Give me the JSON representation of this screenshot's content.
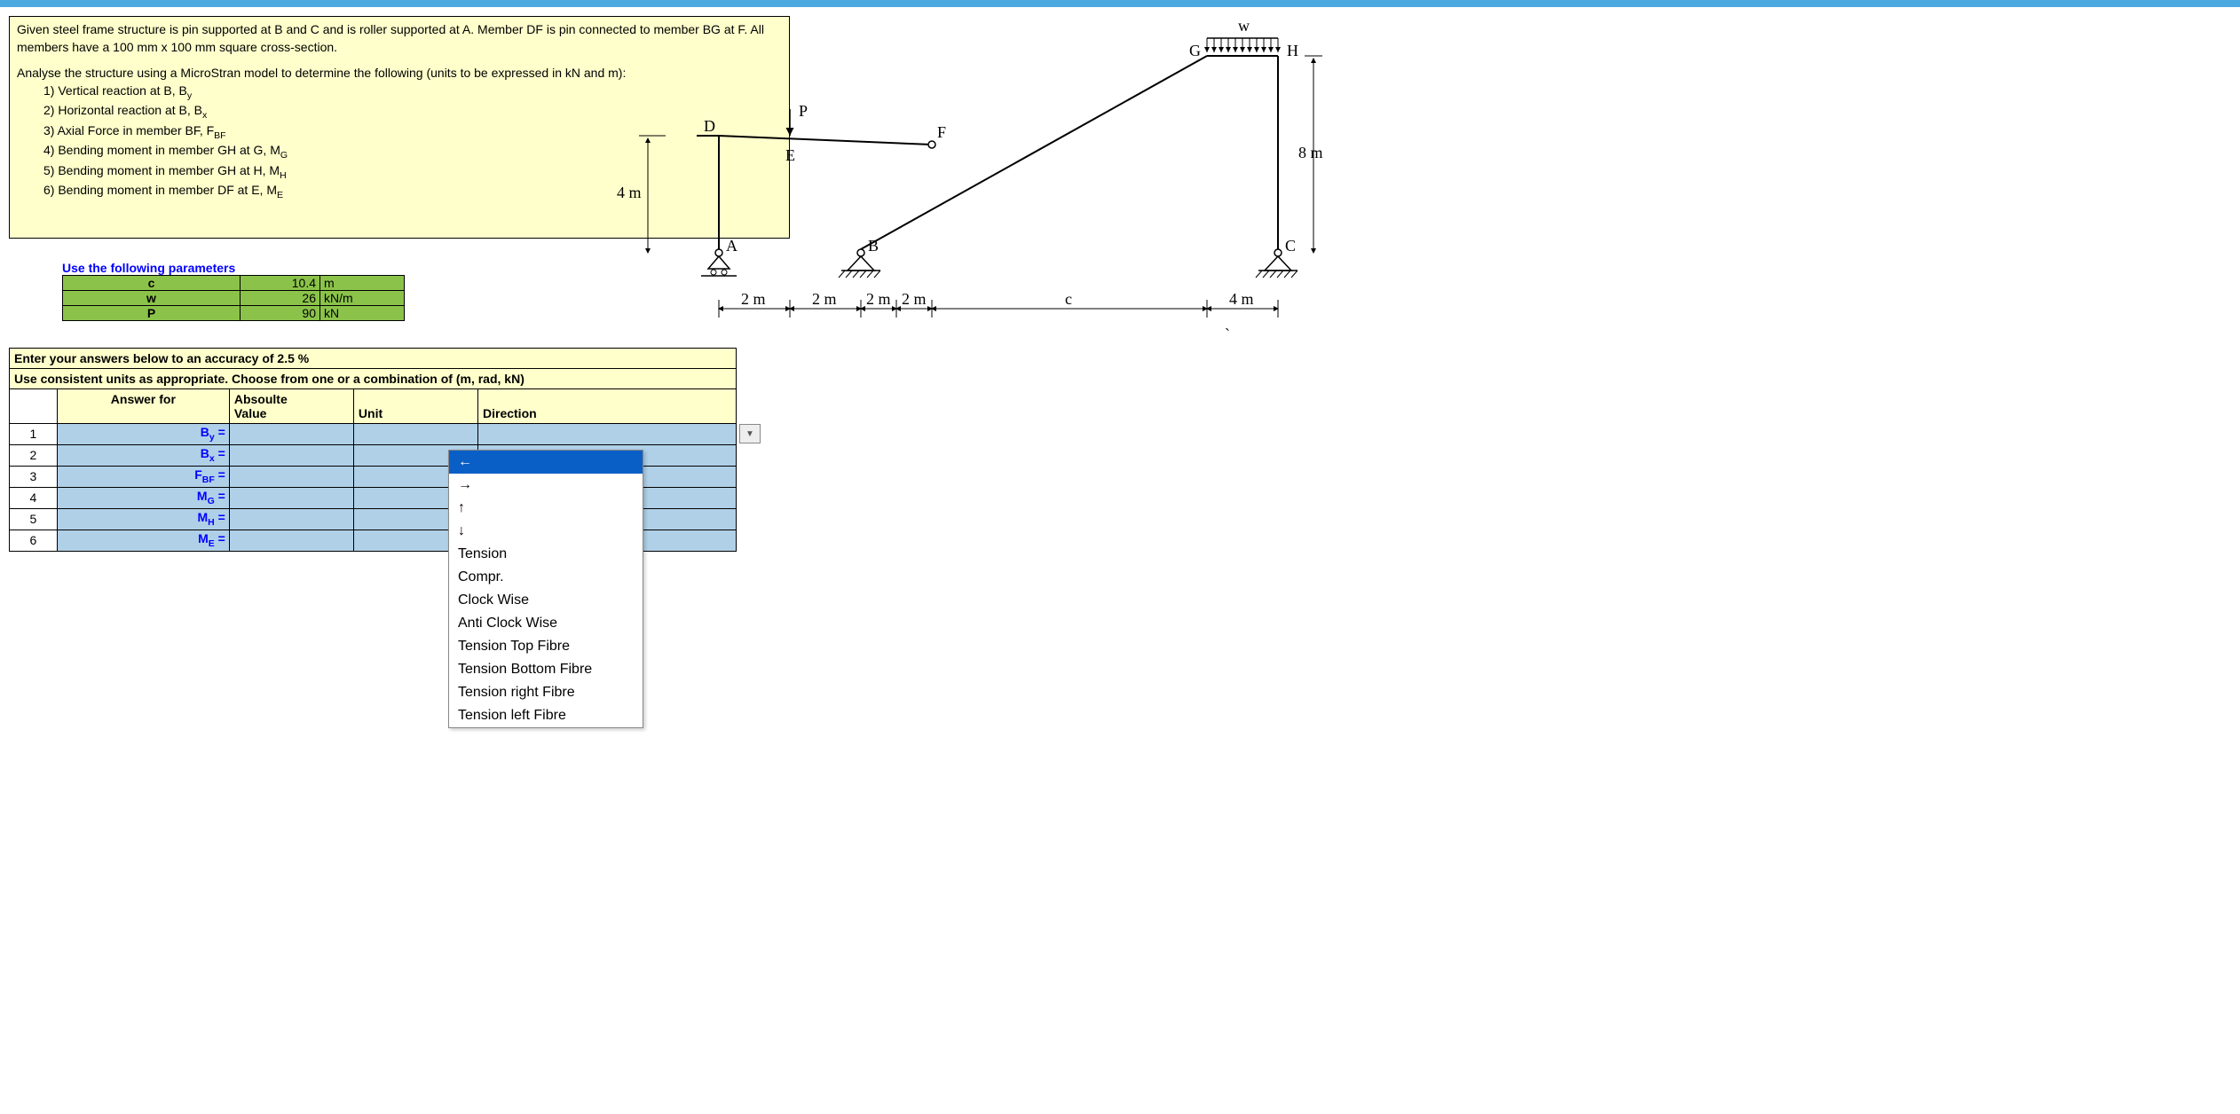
{
  "problem": {
    "intro": "Given steel frame structure is pin supported at B and C and is roller supported at A. Member DF is pin connected to member BG at F. All members have a 100  mm x 100 mm square cross-section.",
    "task": "Analyse the structure using a MicroStran model to determine the following (units to be expressed in kN and m):",
    "items": [
      "1) Vertical reaction at B,  Bᵧ",
      "2) Horizontal reaction at B, Bₓ",
      "3) Axial Force in member BF, F_BF",
      "4) Bending moment in member GH at G, M_G",
      "5) Bending moment in member GH at H, M_H",
      "6) Bending moment in member DF at E, M_E"
    ]
  },
  "params": {
    "title": "Use the following parameters",
    "rows": [
      {
        "name": "c",
        "value": "10.4",
        "unit": "m"
      },
      {
        "name": "w",
        "value": "26",
        "unit": "kN/m"
      },
      {
        "name": "P",
        "value": "90",
        "unit": "kN"
      }
    ]
  },
  "answers": {
    "header1": "Enter your answers below to an accuracy of 2.5 %",
    "header2": "Use consistent units as appropriate.  Choose from one or a combination of  (m, rad,  kN)",
    "cols": {
      "answer_for": "Answer for",
      "value": "Absoulte Value",
      "unit": "Unit",
      "direction": "Direction"
    },
    "rows": [
      {
        "idx": "1",
        "label": "Bᵧ ="
      },
      {
        "idx": "2",
        "label": "Bₓ ="
      },
      {
        "idx": "3",
        "label": "F_BF ="
      },
      {
        "idx": "4",
        "label": "M_G ="
      },
      {
        "idx": "5",
        "label": "M_H ="
      },
      {
        "idx": "6",
        "label": "M_E ="
      }
    ]
  },
  "dropdown": {
    "options": [
      "←",
      "→",
      "↑",
      "↓",
      "Tension",
      "Compr.",
      "Clock Wise",
      "Anti Clock Wise",
      "Tension Top Fibre",
      "Tension Bottom Fibre",
      "Tension right Fibre",
      "Tension left Fibre"
    ],
    "selected_index": 0
  },
  "diagram": {
    "labels": {
      "w": "w",
      "P": "P",
      "A": "A",
      "B": "B",
      "C": "C",
      "D": "D",
      "E": "E",
      "F": "F",
      "G": "G",
      "H": "H"
    },
    "dims": {
      "h4": "4 m",
      "h8": "8 m",
      "d1": "2 m",
      "d2": "2 m",
      "d3": "2 m",
      "d4": "2 m",
      "dc": "c",
      "d5": "4 m"
    }
  }
}
